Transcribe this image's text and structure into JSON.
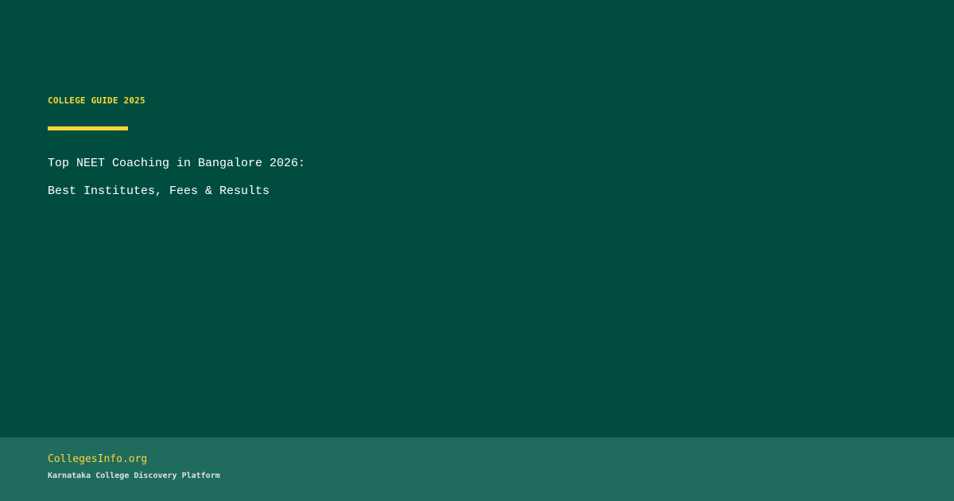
{
  "header": {
    "eyebrow": "COLLEGE GUIDE 2025",
    "title_lines": [
      "Top NEET Coaching in Bangalore 2026:",
      "Best Institutes, Fees & Results"
    ]
  },
  "footer": {
    "brand": "CollegesInfo.org",
    "tagline": "Karnataka College Discovery Platform"
  },
  "colors": {
    "background": "#004D40",
    "footer_background": "#1F6B5E",
    "accent": "#FDD835",
    "title_text": "#FFFFFF",
    "tagline_text": "#E0E0E0"
  }
}
